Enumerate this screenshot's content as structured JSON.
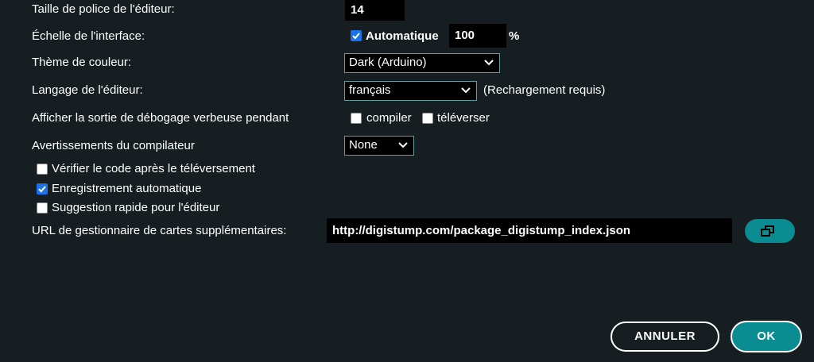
{
  "settings": {
    "font_size": {
      "label": "Taille de police de l'éditeur:",
      "value": "14"
    },
    "scale": {
      "label": "Échelle de l'interface:",
      "auto_label": "Automatique",
      "auto_checked": true,
      "value": "100",
      "unit": "%"
    },
    "theme": {
      "label": "Thème de couleur:",
      "selected": "Dark (Arduino)"
    },
    "language": {
      "label": "Langage de l'éditeur:",
      "selected": "français",
      "note": "(Rechargement requis)"
    },
    "verbose": {
      "label": "Afficher la sortie de débogage verbeuse pendant",
      "compile_label": "compiler",
      "compile_checked": false,
      "upload_label": "téléverser",
      "upload_checked": false
    },
    "warnings": {
      "label": "Avertissements du compilateur",
      "selected": "None"
    },
    "verify_after_upload": {
      "label": "Vérifier le code après le téléversement",
      "checked": false
    },
    "auto_save": {
      "label": "Enregistrement automatique",
      "checked": true
    },
    "quick_suggestions": {
      "label": "Suggestion rapide pour l'éditeur",
      "checked": false
    },
    "board_urls": {
      "label": "URL de gestionnaire de cartes supplémentaires:",
      "value": "http://digistump.com/package_digistump_index.json",
      "button_icon": "open-window-icon"
    }
  },
  "footer": {
    "cancel_label": "ANNULER",
    "ok_label": "OK"
  },
  "colors": {
    "background": "#171e21",
    "accent": "#0b8c92",
    "checkbox_checked": "#1a73e8"
  }
}
